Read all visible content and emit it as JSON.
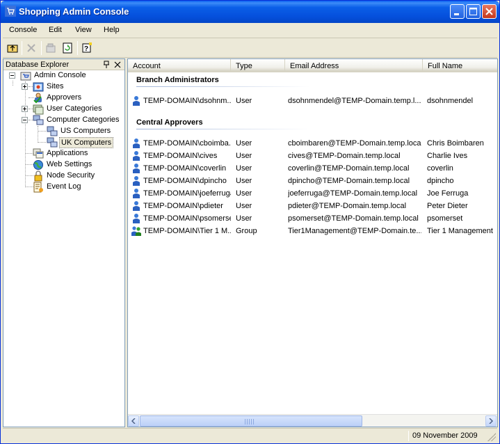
{
  "window": {
    "title": "Shopping Admin Console"
  },
  "menu": {
    "items": [
      "Console",
      "Edit",
      "View",
      "Help"
    ]
  },
  "toolbar": {
    "buttons": [
      "up-folder-icon",
      "delete-icon",
      "properties-icon",
      "refresh-icon",
      "help-icon"
    ]
  },
  "explorer": {
    "title": "Database Explorer",
    "nodes": [
      {
        "label": "Admin Console",
        "icon": "admin-console-icon"
      },
      {
        "label": "Sites",
        "icon": "sites-icon"
      },
      {
        "label": "Approvers",
        "icon": "approvers-icon"
      },
      {
        "label": "User Categories",
        "icon": "user-categories-icon"
      },
      {
        "label": "Computer Categories",
        "icon": "computer-categories-icon"
      },
      {
        "label": "US Computers",
        "icon": "computers-icon"
      },
      {
        "label": "UK Computers",
        "icon": "computers-icon",
        "selected": true
      },
      {
        "label": "Applications",
        "icon": "applications-icon"
      },
      {
        "label": "Web Settings",
        "icon": "web-settings-icon"
      },
      {
        "label": "Node Security",
        "icon": "lock-icon"
      },
      {
        "label": "Event Log",
        "icon": "event-log-icon"
      }
    ]
  },
  "list": {
    "columns": [
      "Account",
      "Type",
      "Email Address",
      "Full Name"
    ],
    "groups": [
      {
        "title": "Branch Administrators",
        "rows": [
          {
            "account": "TEMP-DOMAIN\\dsohnm...",
            "type": "User",
            "email": "dsohnmendel@TEMP-Domain.temp.l...",
            "name": "dsohnmendel",
            "kind": "user"
          }
        ]
      },
      {
        "title": "Central Approvers",
        "rows": [
          {
            "account": "TEMP-DOMAIN\\cboimba...",
            "type": "User",
            "email": "cboimbaren@TEMP-Domain.temp.local",
            "name": "Chris Boimbaren",
            "kind": "user"
          },
          {
            "account": "TEMP-DOMAIN\\cives",
            "type": "User",
            "email": "cives@TEMP-Domain.temp.local",
            "name": "Charlie Ives",
            "kind": "user"
          },
          {
            "account": "TEMP-DOMAIN\\coverlin",
            "type": "User",
            "email": "coverlin@TEMP-Domain.temp.local",
            "name": "coverlin",
            "kind": "user"
          },
          {
            "account": "TEMP-DOMAIN\\dpincho",
            "type": "User",
            "email": "dpincho@TEMP-Domain.temp.local",
            "name": "dpincho",
            "kind": "user"
          },
          {
            "account": "TEMP-DOMAIN\\joeferruga",
            "type": "User",
            "email": "joeferruga@TEMP-Domain.temp.local",
            "name": "Joe Ferruga",
            "kind": "user"
          },
          {
            "account": "TEMP-DOMAIN\\pdieter",
            "type": "User",
            "email": "pdieter@TEMP-Domain.temp.local",
            "name": "Peter Dieter",
            "kind": "user"
          },
          {
            "account": "TEMP-DOMAIN\\psomerset",
            "type": "User",
            "email": "psomerset@TEMP-Domain.temp.local",
            "name": "psomerset",
            "kind": "user"
          },
          {
            "account": "TEMP-DOMAIN\\Tier 1 M...",
            "type": "Group",
            "email": "Tier1Management@TEMP-Domain.te...",
            "name": "Tier 1 Management",
            "kind": "group"
          }
        ]
      }
    ]
  },
  "status": {
    "date": "09 November 2009"
  },
  "colors": {
    "titlebar": "#0550dc",
    "chrome": "#ece9d8",
    "border": "#7f9db9"
  }
}
